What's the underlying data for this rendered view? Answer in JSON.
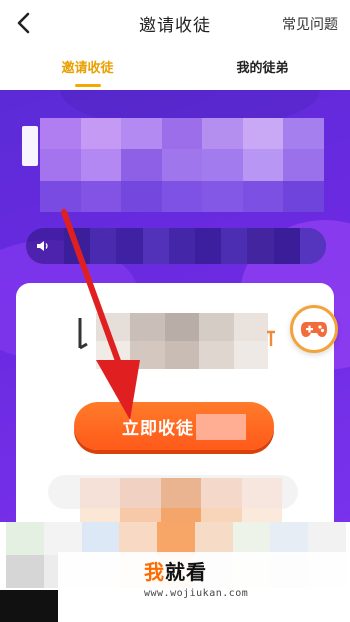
{
  "header": {
    "title": "邀请收徒",
    "faq_label": "常见问题"
  },
  "tabs": [
    {
      "label": "邀请收徒",
      "active": true
    },
    {
      "label": "我的徒弟",
      "active": false
    }
  ],
  "card": {
    "cta_label": "立即收徒"
  },
  "watermark": {
    "brand_part1": "我",
    "brand_part2": "就看",
    "url": "www.wojiukan.com"
  },
  "icons": {
    "back": "chevron-left-icon",
    "speaker": "speaker-icon",
    "game": "gamepad-icon"
  },
  "colors": {
    "accent": "#e9a000",
    "banner": "#6a2ae0",
    "cta": "#ff6422",
    "arrow": "#e02020"
  }
}
